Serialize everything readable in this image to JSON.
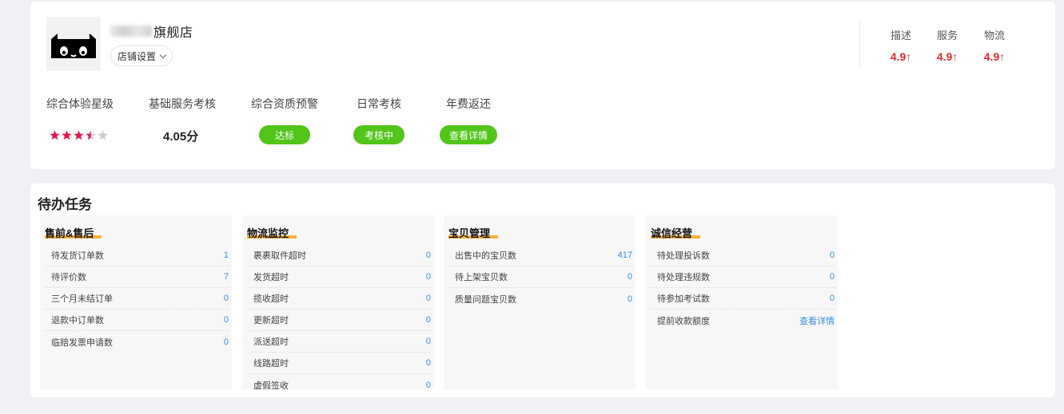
{
  "shop": {
    "name": "旗舰店",
    "settings_label": "店铺设置"
  },
  "ratings": [
    {
      "label": "描述",
      "value": "4.9↑"
    },
    {
      "label": "服务",
      "value": "4.9↑"
    },
    {
      "label": "物流",
      "value": "4.9↑"
    }
  ],
  "metrics": {
    "experience_label": "综合体验星级",
    "experience_stars": 3.5,
    "experience_stars_max": 5,
    "basic_service_label": "基础服务考核",
    "basic_service_score": "4.05分",
    "qualification_label": "综合资质预警",
    "qualification_status": "达标",
    "daily_label": "日常考核",
    "daily_status": "考核中",
    "fee_label": "年费返还",
    "fee_action": "查看详情"
  },
  "colors": {
    "star_active": "#e8164d",
    "star_inactive": "#cccccc",
    "pill_green": "#52c41a",
    "rating_red": "#e0282e",
    "link_blue": "#3a8ee6",
    "highlight_orange": "#f5b13a"
  },
  "tasks": {
    "title": "待办任务",
    "columns": [
      {
        "title": "售前&售后",
        "rows": [
          {
            "label": "待发货订单数",
            "value": "1"
          },
          {
            "label": "待评价数",
            "value": "7"
          },
          {
            "label": "三个月未结订单",
            "value": "0"
          },
          {
            "label": "退款中订单数",
            "value": "0"
          },
          {
            "label": "临赔发票申请数",
            "value": "0"
          }
        ]
      },
      {
        "title": "物流监控",
        "rows": [
          {
            "label": "裹裹取件超时",
            "value": "0"
          },
          {
            "label": "发货超时",
            "value": "0"
          },
          {
            "label": "揽收超时",
            "value": "0"
          },
          {
            "label": "更新超时",
            "value": "0"
          },
          {
            "label": "派送超时",
            "value": "0"
          },
          {
            "label": "线路超时",
            "value": "0"
          },
          {
            "label": "虚假签收",
            "value": "0"
          }
        ]
      },
      {
        "title": "宝贝管理",
        "rows": [
          {
            "label": "出售中的宝贝数",
            "value": "417"
          },
          {
            "label": "待上架宝贝数",
            "value": "0"
          },
          {
            "label": "质量问题宝贝数",
            "value": "0"
          }
        ]
      },
      {
        "title": "诚信经营",
        "rows": [
          {
            "label": "待处理投诉数",
            "value": "0"
          },
          {
            "label": "待处理违规数",
            "value": "0"
          },
          {
            "label": "待参加考试数",
            "value": "0"
          },
          {
            "label": "提前收款额度",
            "value": "查看详情"
          }
        ]
      }
    ]
  }
}
